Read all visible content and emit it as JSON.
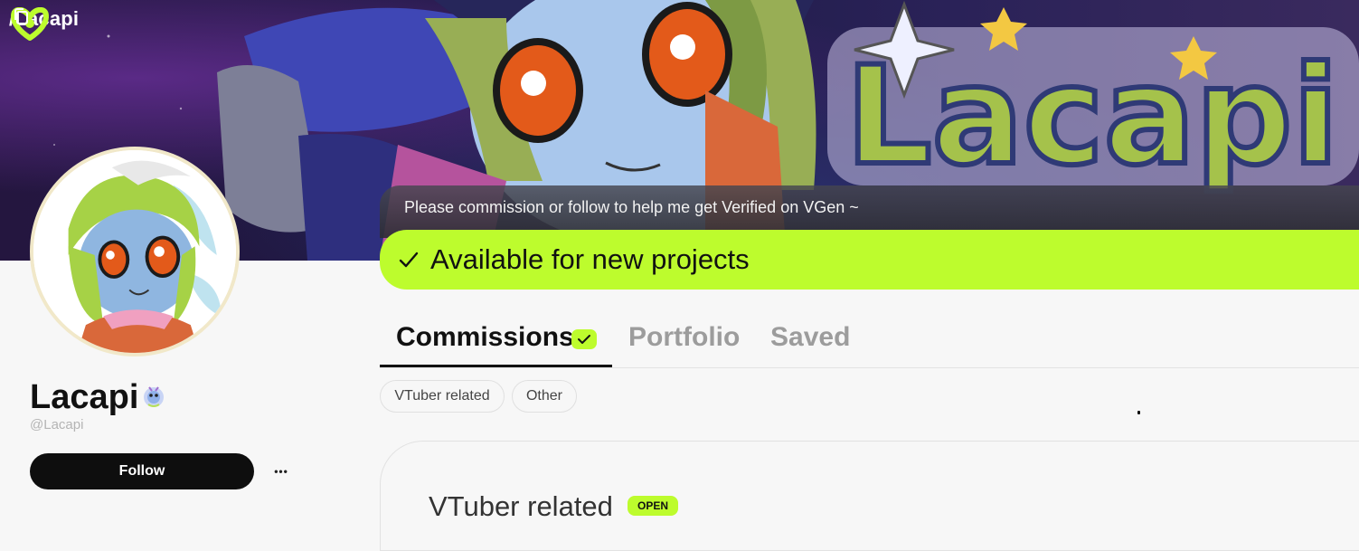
{
  "header": {
    "handle": "/Lacapi"
  },
  "banner": {
    "art_text": "Lacapi"
  },
  "profile": {
    "display_name": "Lacapi",
    "username": "@Lacapi",
    "follow_label": "Follow",
    "more_label": "•••"
  },
  "announcement": "Please commission or follow to help me get Verified on VGen ~",
  "availability": {
    "check": "✓",
    "label": "Available for new projects"
  },
  "tabs": [
    {
      "label": "Commissions",
      "active": true
    },
    {
      "label": "Portfolio",
      "active": false
    },
    {
      "label": "Saved",
      "active": false
    }
  ],
  "filters": [
    "VTuber related",
    "Other"
  ],
  "commission_card": {
    "title": "VTuber related",
    "badge": "OPEN"
  },
  "colors": {
    "accent": "#bdfc2d",
    "button_dark": "#0e0e0e",
    "banner_dark": "#22183f"
  }
}
